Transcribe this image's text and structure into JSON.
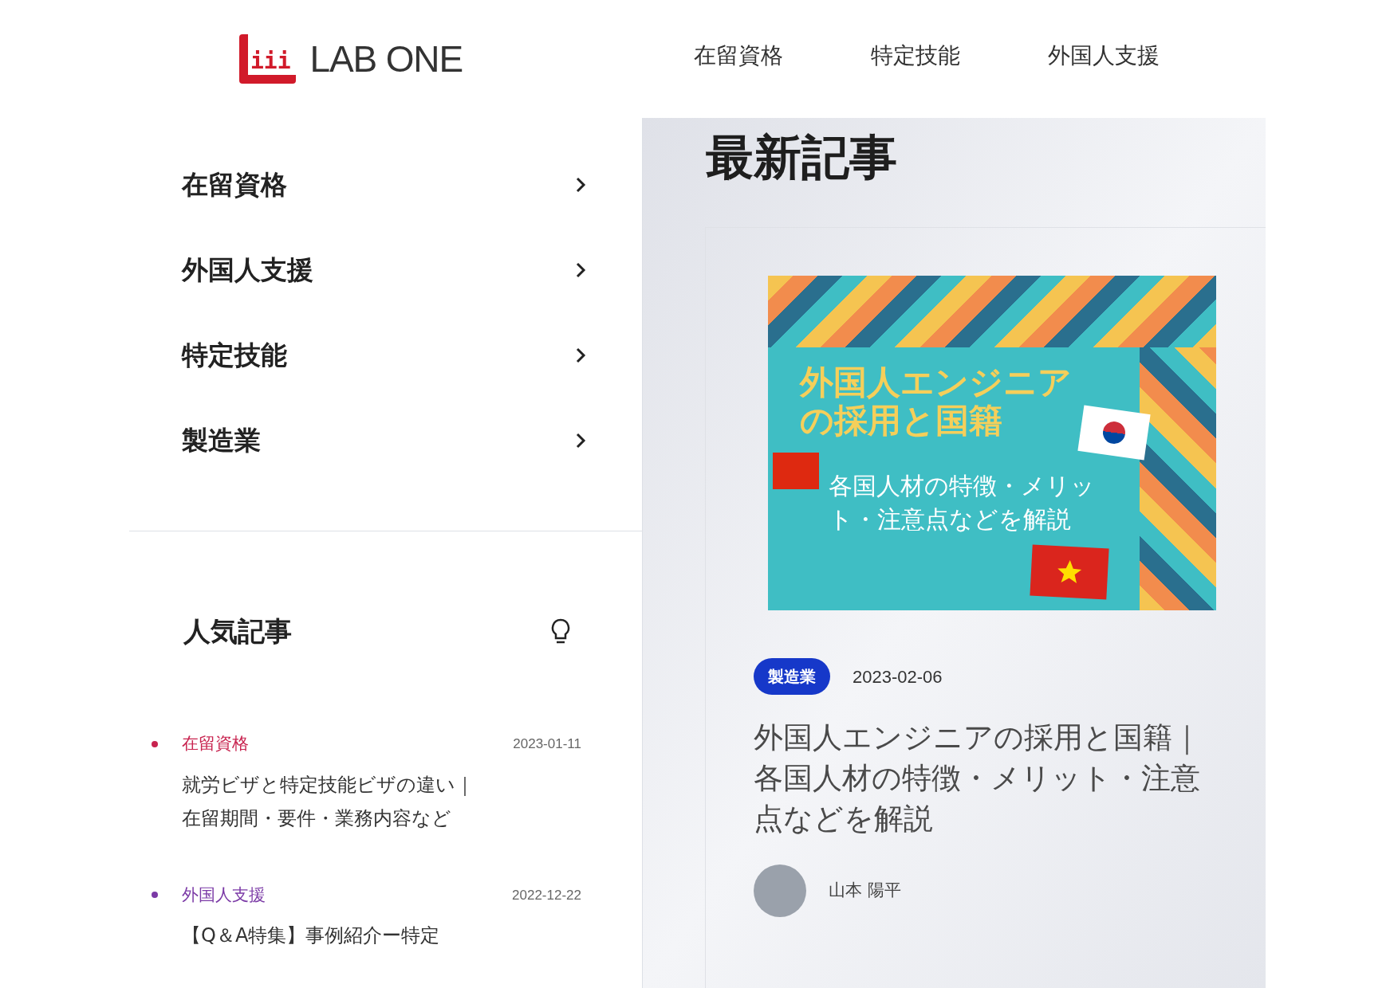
{
  "header": {
    "logo": {
      "mark": "iii",
      "text": "LAB ONE"
    },
    "nav": [
      {
        "label": "在留資格"
      },
      {
        "label": "特定技能"
      },
      {
        "label": "外国人支援"
      }
    ]
  },
  "category_menu": [
    {
      "label": "在留資格"
    },
    {
      "label": "外国人支援"
    },
    {
      "label": "特定技能"
    },
    {
      "label": "製造業"
    }
  ],
  "popular": {
    "title": "人気記事",
    "articles": [
      {
        "category": "在留資格",
        "color": "#c8234f",
        "date": "2023-01-11",
        "title": "就労ビザと特定技能ビザの違い｜在留期間・要件・業務内容など"
      },
      {
        "category": "外国人支援",
        "color": "#7b3aa6",
        "date": "2022-12-22",
        "title": "【Q＆A特集】事例紹介ー特定"
      }
    ]
  },
  "latest": {
    "title": "最新記事",
    "article": {
      "thumbnail": {
        "heading": "外国人エンジニアの採用と国籍",
        "subheading": "各国人材の特徴・メリット・注意点などを解説"
      },
      "tag": "製造業",
      "date": "2023-02-06",
      "title": "外国人エンジニアの採用と国籍｜各国人材の特徴・メリット・注意点などを解説",
      "author": "山本 陽平"
    }
  }
}
